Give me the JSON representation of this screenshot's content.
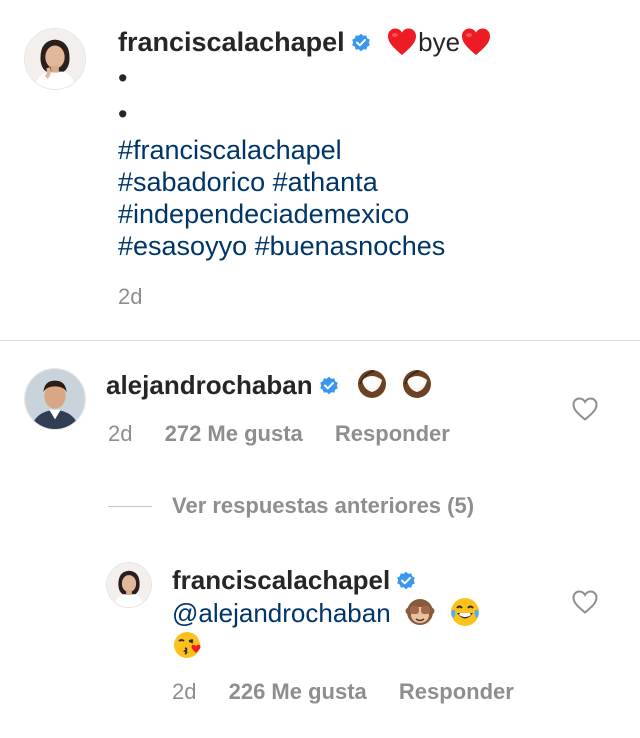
{
  "caption": {
    "username": "franciscalachapel",
    "text_after": "bye",
    "bullets": [
      "•",
      "•"
    ],
    "hashtags_lines": [
      "#franciscalachapel",
      "#sabadorico #athanta",
      "#independeciademexico",
      "#esasoyyo #buenasnoches"
    ],
    "time": "2d"
  },
  "comment": {
    "username": "alejandrochaban",
    "time": "2d",
    "likes": "272 Me gusta",
    "reply_label": "Responder"
  },
  "view_replies_label": "Ver respuestas anteriores (5)",
  "reply": {
    "username": "franciscalachapel",
    "mention": "@alejandrochaban",
    "time": "2d",
    "likes": "226 Me gusta",
    "reply_label": "Responder"
  },
  "colors": {
    "text": "#262626",
    "secondary": "#8e8e8e",
    "link": "#003569",
    "verified": "#3897f0",
    "heart": "#ed1c24",
    "divider": "#dbdbdb"
  },
  "icons": {
    "verified": "verified-badge-icon",
    "heart": "red-heart-emoji",
    "coconut": "coconut-emoji",
    "see_no_evil": "see-no-evil-monkey-emoji",
    "tears_of_joy": "face-with-tears-of-joy-emoji",
    "kiss": "face-blowing-kiss-emoji",
    "like": "heart-outline-icon"
  }
}
